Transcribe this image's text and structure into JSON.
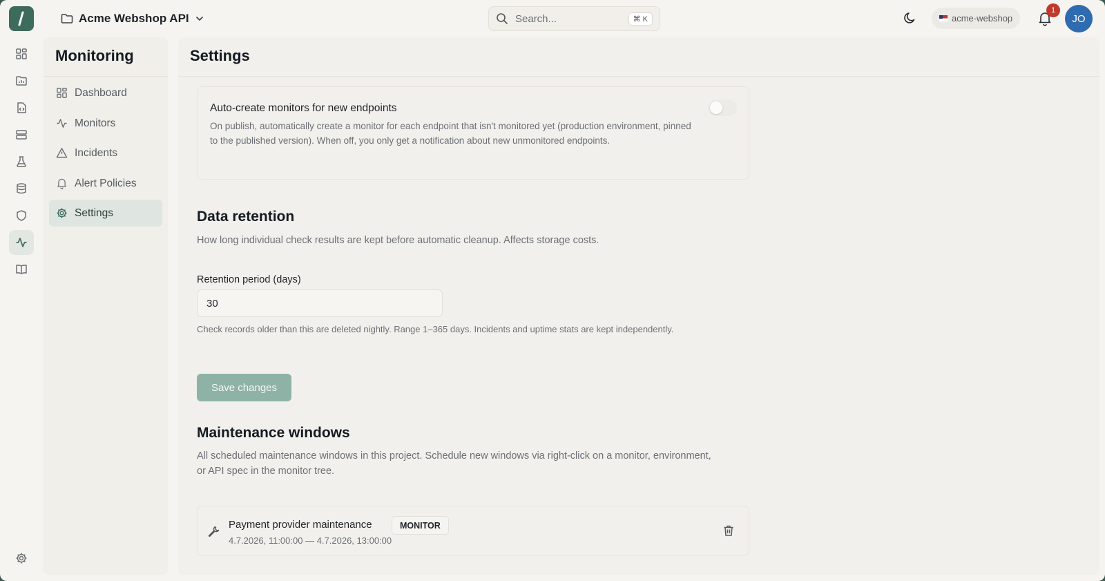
{
  "header": {
    "project_name": "Acme Webshop API",
    "search_placeholder": "Search...",
    "search_shortcut": "⌘ K",
    "org_name": "acme-webshop",
    "notification_count": "1",
    "avatar_initials": "JO"
  },
  "rail": {
    "icons": [
      "dashboard-icon",
      "chart-folder-icon",
      "code-file-icon",
      "server-icon",
      "flask-icon",
      "database-icon",
      "shield-icon",
      "activity-icon",
      "book-icon",
      "gear-icon"
    ],
    "active": "activity-icon"
  },
  "sidebar": {
    "title": "Monitoring",
    "items": [
      {
        "label": "Dashboard",
        "icon": "dashboard-icon"
      },
      {
        "label": "Monitors",
        "icon": "activity-icon"
      },
      {
        "label": "Incidents",
        "icon": "warning-icon"
      },
      {
        "label": "Alert Policies",
        "icon": "bell-icon"
      },
      {
        "label": "Settings",
        "icon": "gear-icon",
        "active": true
      }
    ]
  },
  "main": {
    "title": "Settings",
    "auto_create": {
      "title": "Auto-create monitors for new endpoints",
      "description": "On publish, automatically create a monitor for each endpoint that isn't monitored yet (production environment, pinned to the published version). When off, you only get a notification about new unmonitored endpoints.",
      "enabled": false
    },
    "retention": {
      "heading": "Data retention",
      "description": "How long individual check results are kept before automatic cleanup. Affects storage costs.",
      "field_label": "Retention period (days)",
      "field_value": "30",
      "hint": "Check records older than this are deleted nightly. Range 1–365 days. Incidents and uptime stats are kept independently."
    },
    "save_label": "Save changes",
    "maintenance": {
      "heading": "Maintenance windows",
      "description": "All scheduled maintenance windows in this project. Schedule new windows via right-click on a monitor, environment, or API spec in the monitor tree.",
      "windows": [
        {
          "name": "Payment provider maintenance",
          "scope": "MONITOR",
          "range": "4.7.2026, 11:00:00 — 4.7.2026, 13:00:00"
        }
      ]
    }
  },
  "colors": {
    "accent": "#3d6b5c",
    "save_button": "#8eb3a6",
    "avatar": "#2f6bb0",
    "badge": "#c0392b"
  }
}
